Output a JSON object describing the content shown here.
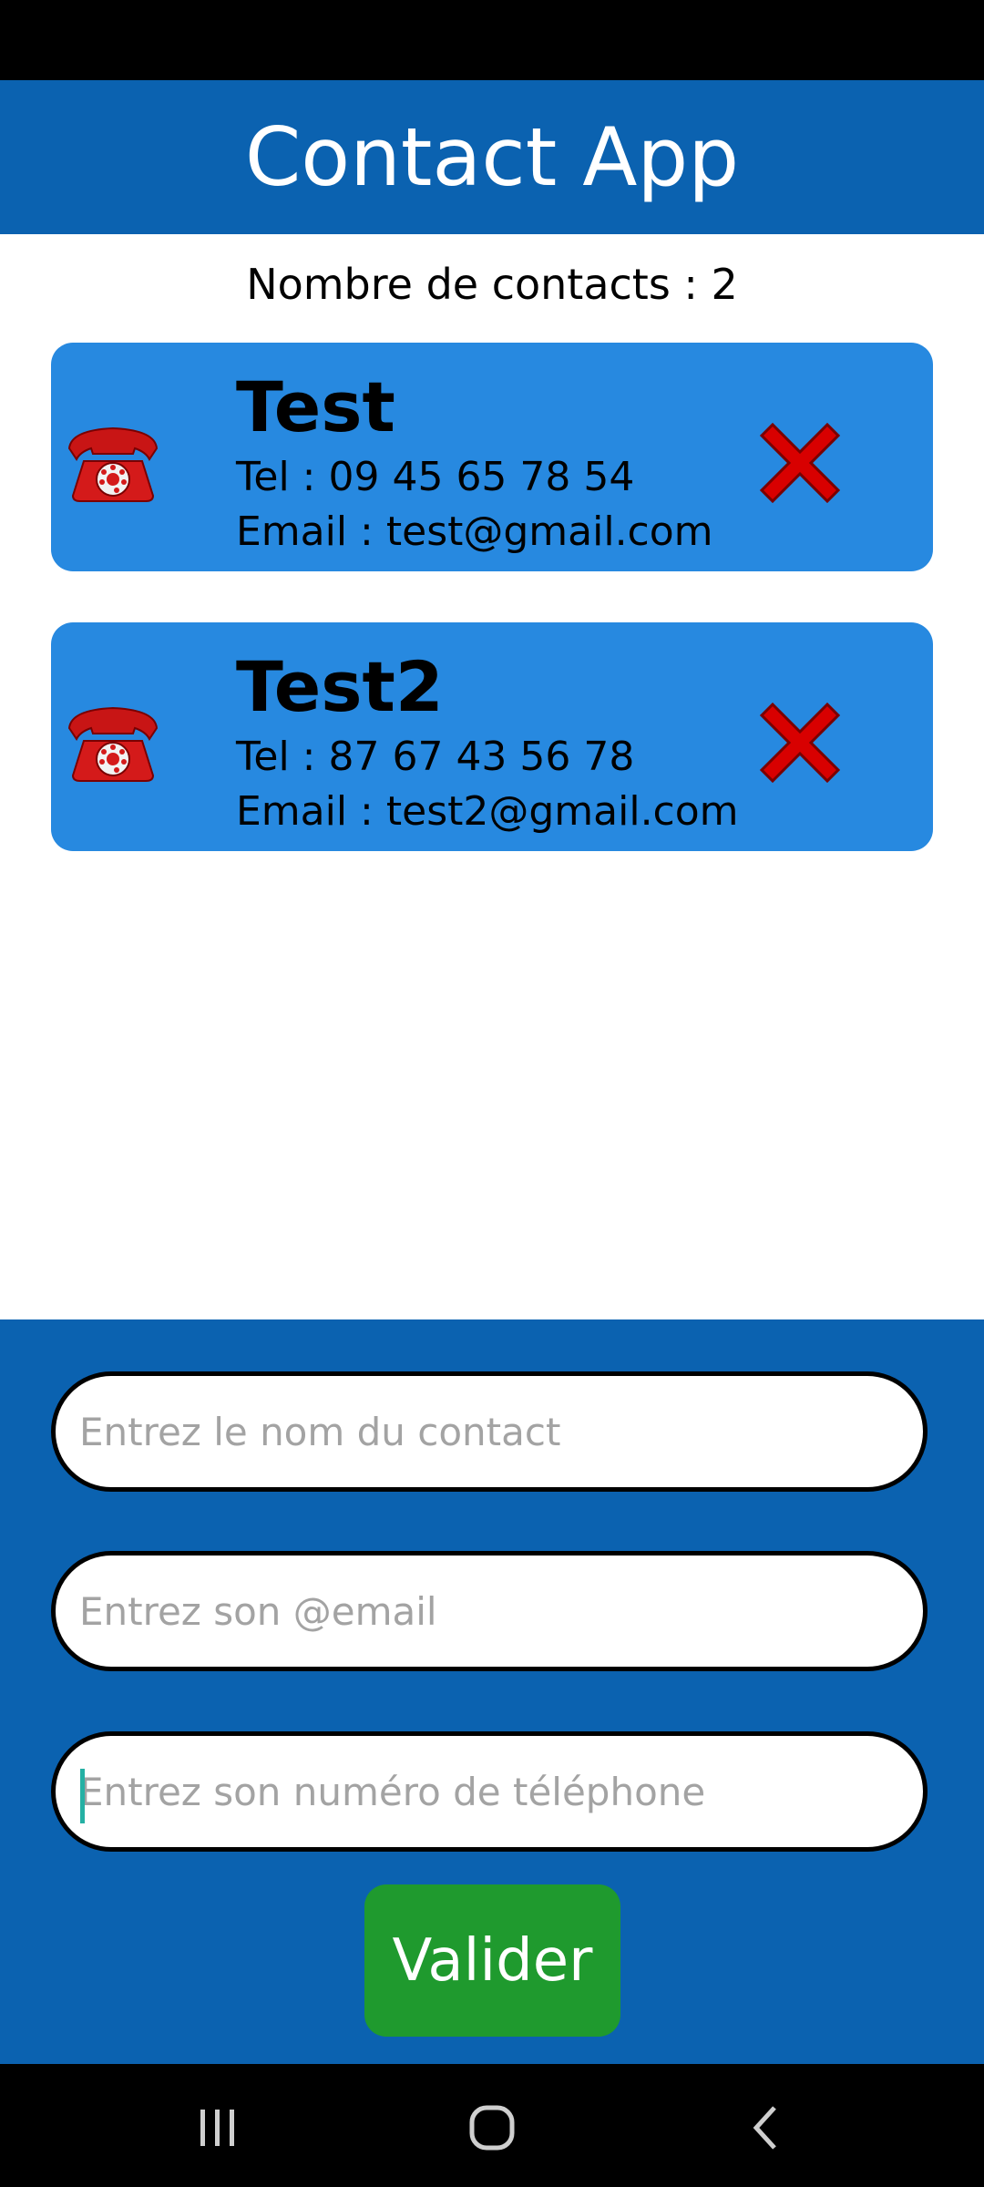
{
  "header": {
    "title": "Contact App"
  },
  "summary": {
    "count_text": "Nombre de contacts : 2"
  },
  "contacts": [
    {
      "name": "Test",
      "tel": "Tel : 09 45 65 78 54",
      "email": "Email : test@gmail.com"
    },
    {
      "name": "Test2",
      "tel": "Tel : 87 67 43 56 78",
      "email": "Email : test2@gmail.com"
    }
  ],
  "icons": {
    "contact": "telephone-icon",
    "delete": "cross-icon"
  },
  "form": {
    "name_placeholder": "Entrez le nom du contact",
    "email_placeholder": "Entrez son @email",
    "phone_placeholder": "Entrez son numéro de téléphone",
    "submit_label": "Valider"
  },
  "colors": {
    "header": "#0b62b0",
    "card": "#2789e0",
    "submit": "#1f9a2e",
    "delete": "#d80000"
  }
}
